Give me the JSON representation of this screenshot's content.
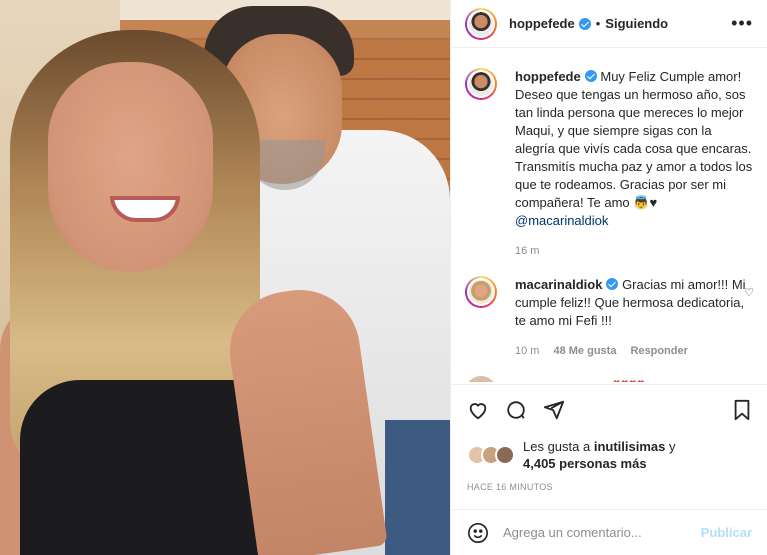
{
  "header": {
    "username": "hoppefede",
    "separator": "•",
    "follow_status": "Siguiendo",
    "more_icon": "more-horizontal-icon"
  },
  "caption": {
    "username": "hoppefede",
    "text": "Muy Feliz Cumple amor! Deseo que tengas un hermoso año, sos tan linda persona que mereces lo mejor Maqui, y que siempre sigas con la alegría que vivís cada cosa que encaras. Transmitís mucha paz y amor a todos los que te rodeamos. Gracias por ser mi compañera! Te amo 👼♥",
    "mention": "@macarinaldiok",
    "time": "16 m"
  },
  "reply": {
    "username": "macarinaldiok",
    "text": "Gracias mi amor!!! Mi cumple feliz!! Que hermosa dedicatoria, te amo mi Fefi !!!",
    "time": "10 m",
    "likes": "48 Me gusta",
    "reply_label": "Responder"
  },
  "likes": {
    "prefix": "Les gusta a",
    "user": "inutilisimas",
    "suffix": "y",
    "others": "4,405 personas más"
  },
  "timestamp": "HACE 16 MINUTOS",
  "add_comment": {
    "placeholder": "Agrega un comentario...",
    "post_label": "Publicar"
  },
  "colors": {
    "verified": "#3897f0",
    "mention": "#00376b",
    "post_disabled": "#b2dffc"
  },
  "icons": [
    "heart-icon",
    "comment-icon",
    "share-icon",
    "bookmark-icon",
    "emoji-icon",
    "verified-badge-icon"
  ]
}
